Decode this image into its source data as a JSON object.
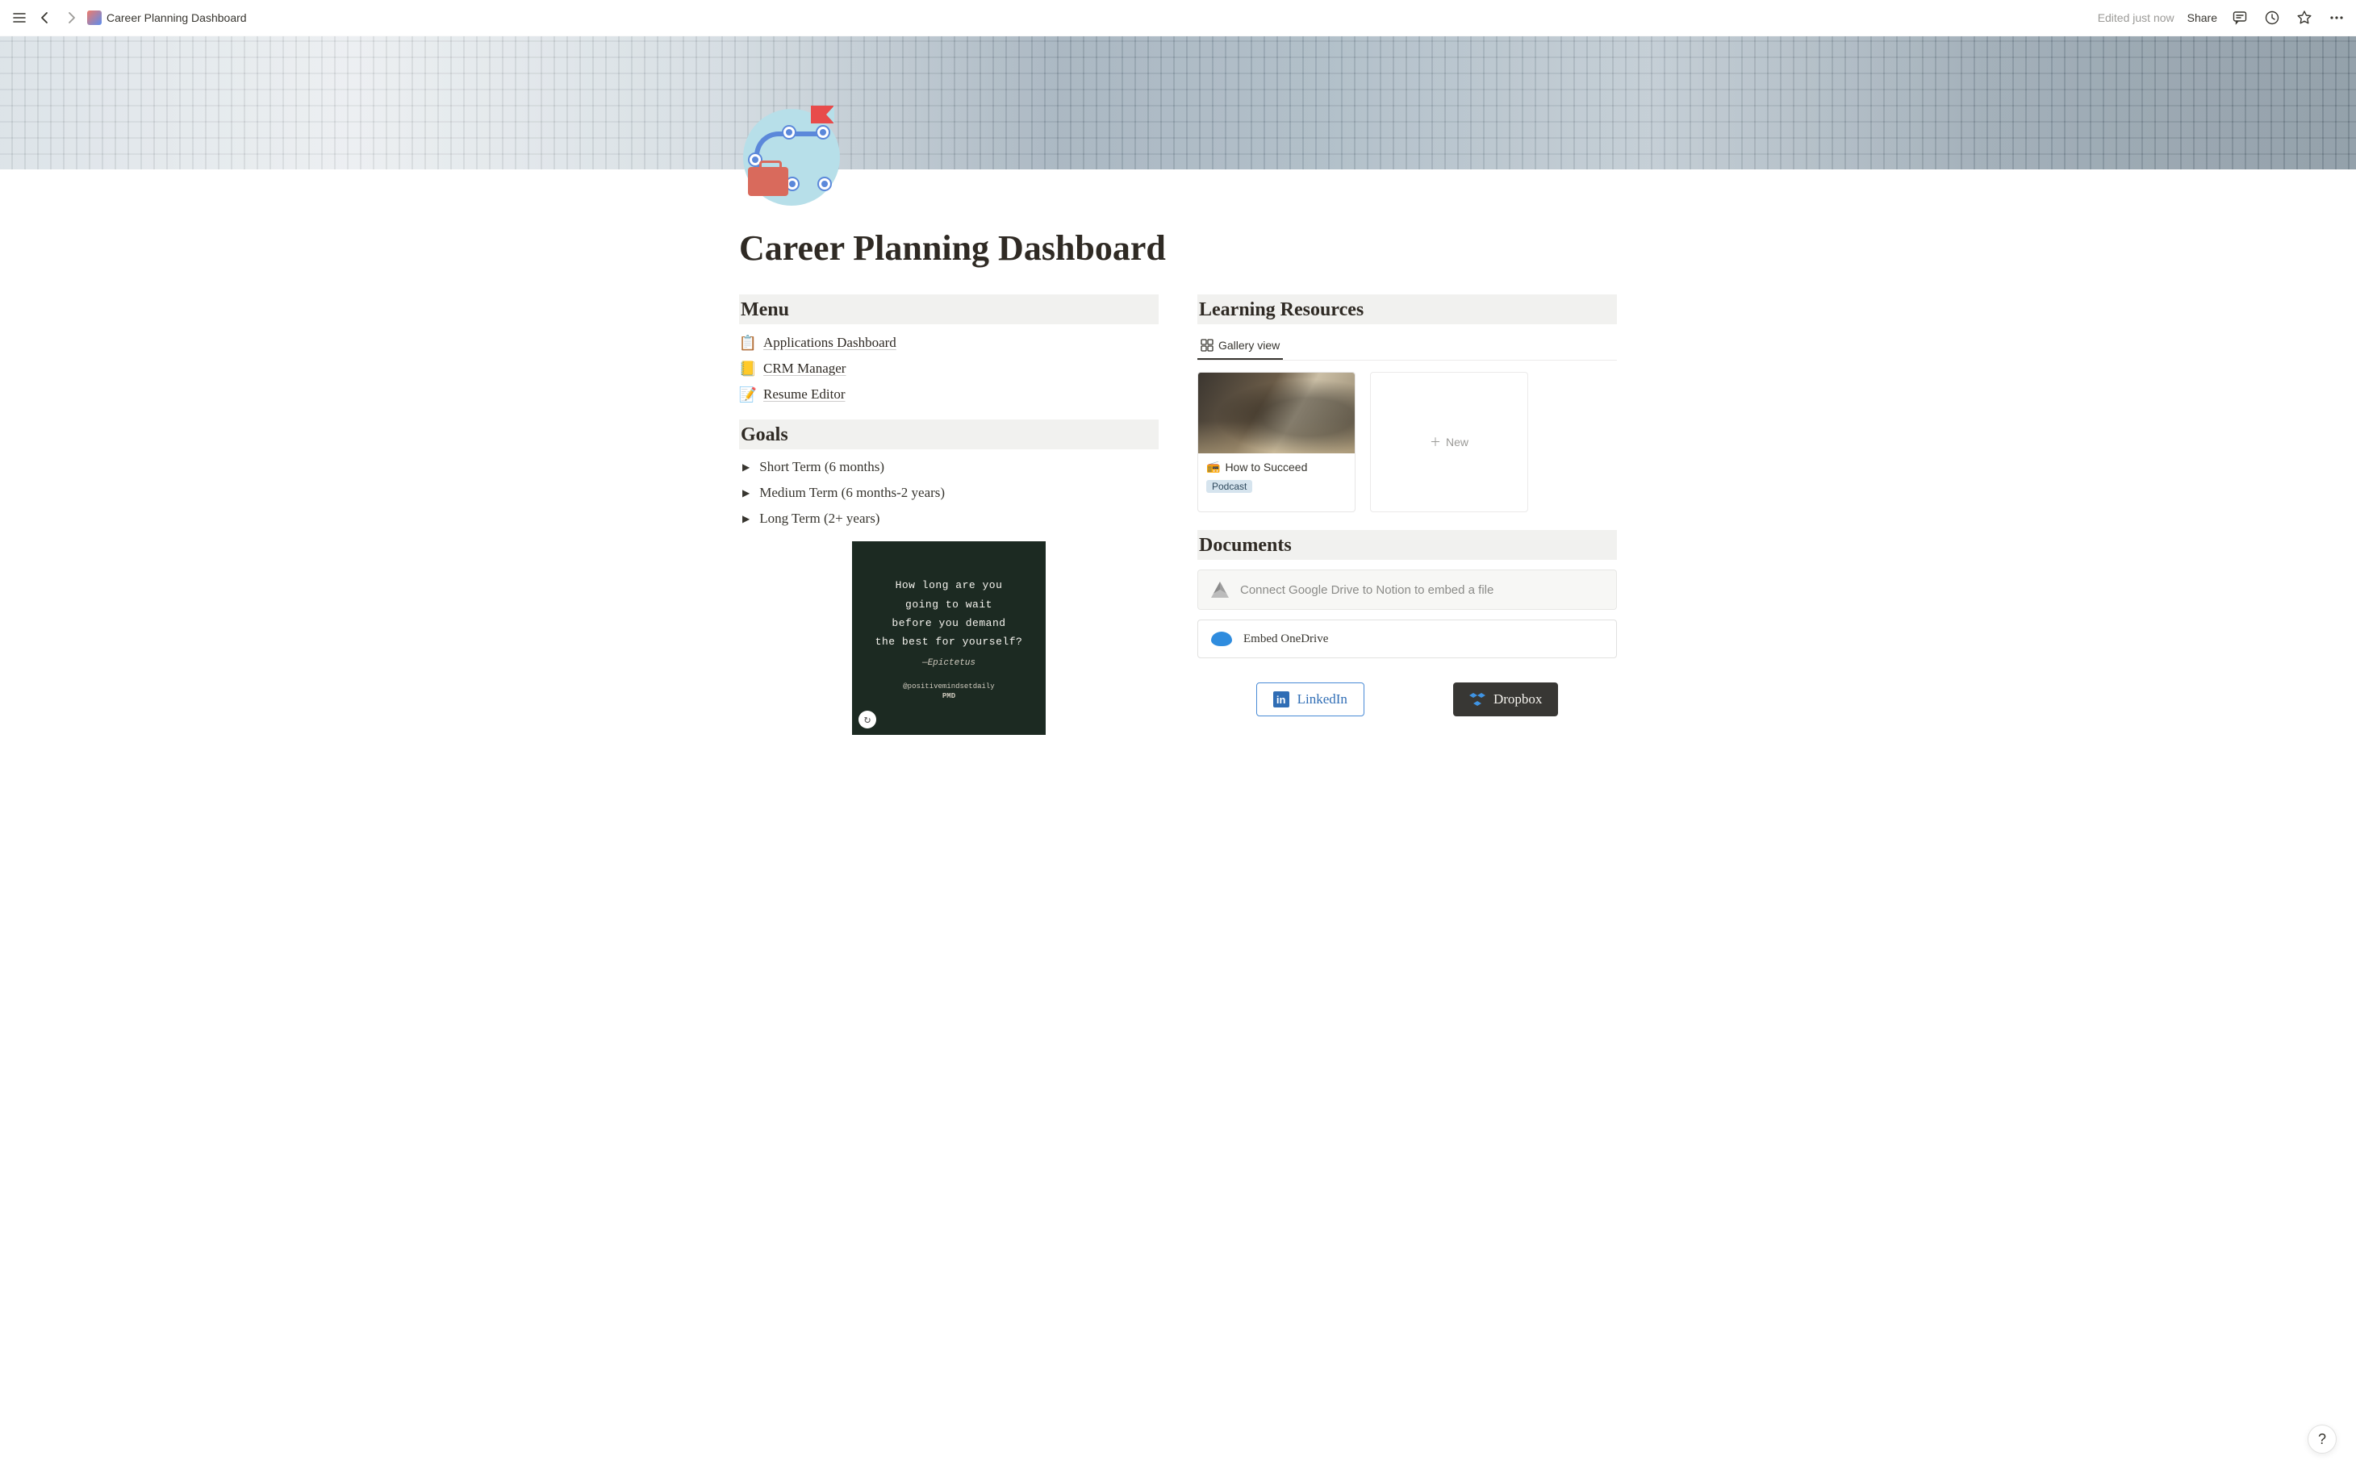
{
  "topbar": {
    "title": "Career Planning Dashboard",
    "edited": "Edited just now",
    "share": "Share"
  },
  "page": {
    "title": "Career Planning Dashboard"
  },
  "menu": {
    "heading": "Menu",
    "items": [
      {
        "icon": "📋",
        "label": "Applications Dashboard"
      },
      {
        "icon": "📒",
        "label": "CRM Manager"
      },
      {
        "icon": "📝",
        "label": "Resume Editor"
      }
    ]
  },
  "goals": {
    "heading": "Goals",
    "items": [
      {
        "label": "Short Term (6 months)"
      },
      {
        "label": "Medium Term (6 months-2 years)"
      },
      {
        "label": "Long Term (2+ years)"
      }
    ]
  },
  "quote": {
    "text": "How long are you\ngoing to wait\nbefore you demand\nthe best for yourself?",
    "author": "—Epictetus",
    "tag": "@positivemindsetdaily",
    "brand": "PMD"
  },
  "resources": {
    "heading": "Learning Resources",
    "view_label": "Gallery view",
    "card": {
      "icon": "📻",
      "title": "How to Succeed",
      "tag": "Podcast"
    },
    "new_label": "New"
  },
  "documents": {
    "heading": "Documents",
    "drive": "Connect Google Drive to Notion to embed a file",
    "onedrive": "Embed OneDrive"
  },
  "buttons": {
    "linkedin": "LinkedIn",
    "dropbox": "Dropbox"
  },
  "help": "?"
}
